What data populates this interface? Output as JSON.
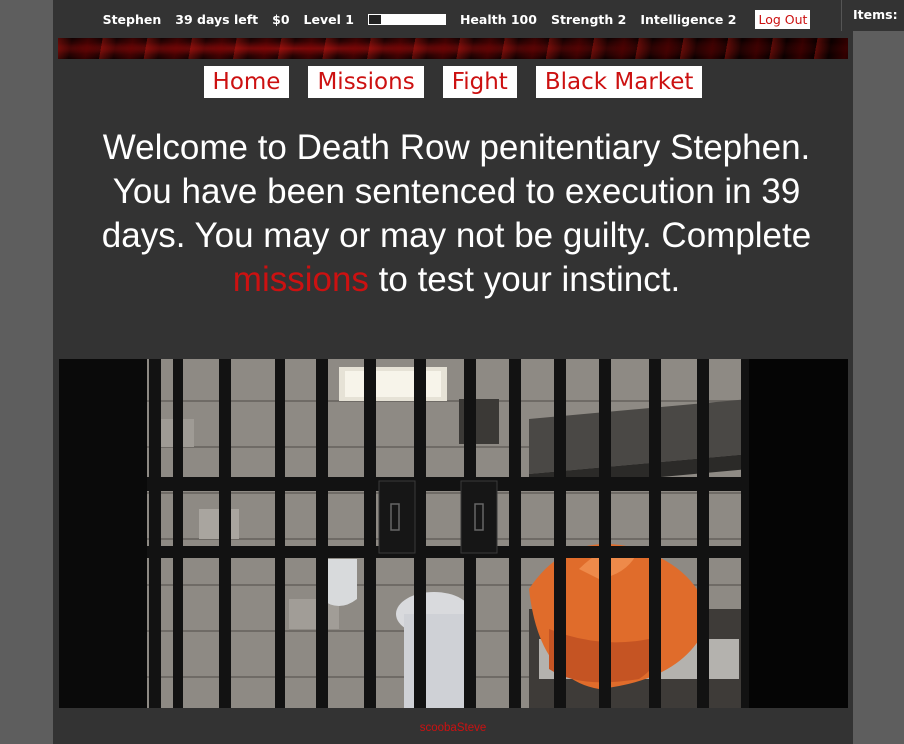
{
  "status": {
    "name": "Stephen",
    "days_left": "39 days left",
    "money": "$0",
    "level": "Level 1",
    "level_progress": 0.16,
    "health": "Health 100",
    "strength": "Strength 2",
    "intelligence": "Intelligence 2",
    "logout_label": "Log Out"
  },
  "items_panel": {
    "label": "Items:"
  },
  "nav": {
    "home": "Home",
    "missions": "Missions",
    "fight": "Fight",
    "black_market": "Black Market"
  },
  "welcome": {
    "before": "Welcome to Death Row penitentiary Stephen. You have been sentenced to execution in 39 days. You may or may not be guilty. Complete ",
    "link": "missions",
    "after": " to test your instinct."
  },
  "footer": {
    "credit": "scoobaSteve"
  },
  "colors": {
    "accent": "#cc1111",
    "page_bg": "#333333",
    "outer_bg": "#5e5e5e"
  },
  "icons": [
    "prison-cell-image",
    "banner-flames-image"
  ]
}
